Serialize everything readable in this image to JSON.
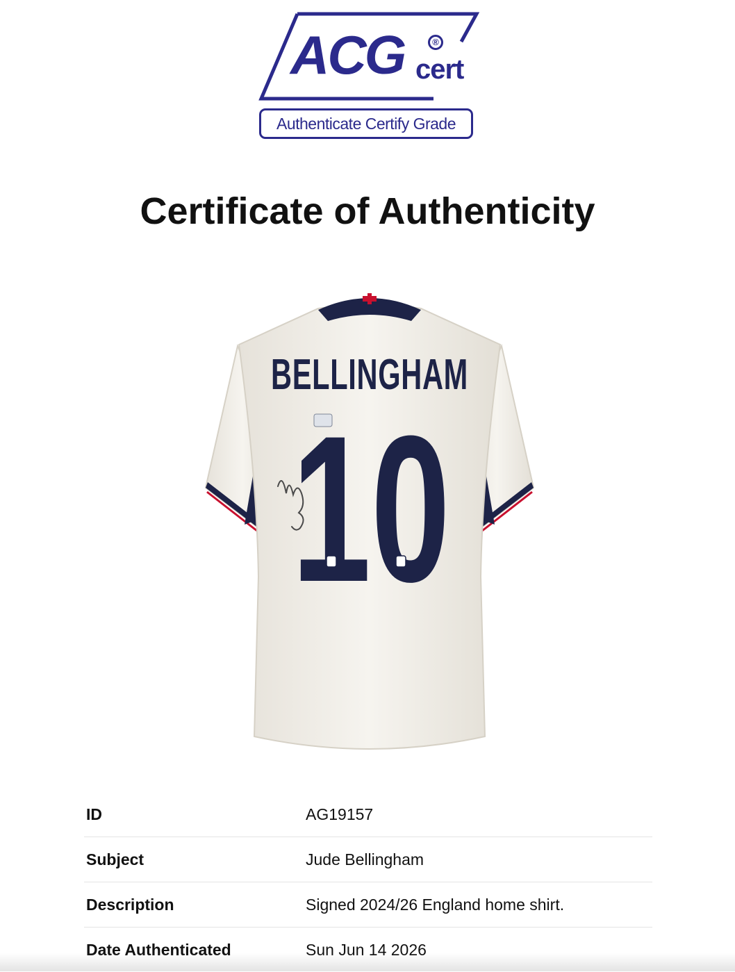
{
  "logo": {
    "wordmark": "ACG",
    "registered_mark": "®",
    "suffix": "cert",
    "tagline": "Authenticate Certify Grade",
    "brand_color": "#2b2a8c"
  },
  "page_title": "Certificate of Authenticity",
  "product_image": {
    "name_print": "BELLINGHAM",
    "number_print": "10",
    "shirt_color": "#f3f1ec",
    "trim_color": "#1d2347",
    "accent_red": "#c8102e"
  },
  "details": [
    {
      "label": "ID",
      "value": "AG19157"
    },
    {
      "label": "Subject",
      "value": "Jude Bellingham"
    },
    {
      "label": "Description",
      "value": "Signed 2024/26 England home shirt."
    },
    {
      "label": "Date Authenticated",
      "value": "Sun Jun 14 2026"
    }
  ]
}
